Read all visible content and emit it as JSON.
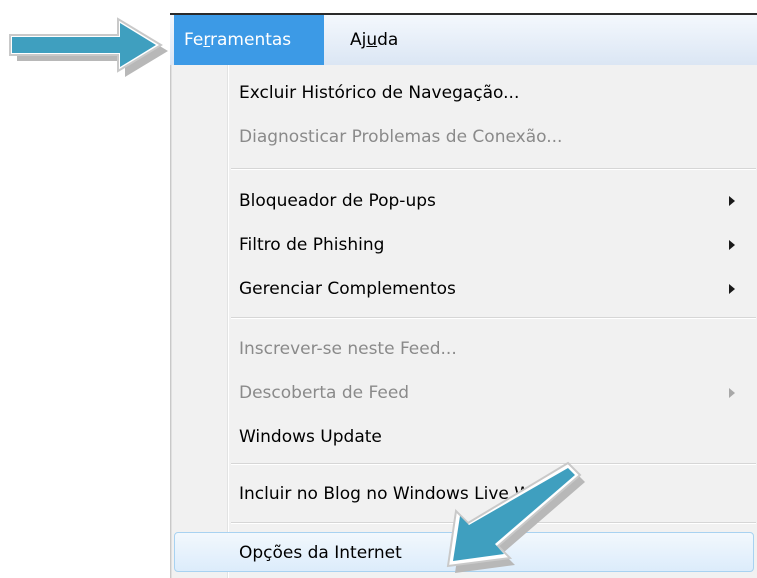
{
  "menubar": {
    "items": [
      {
        "label_pre": "Fe",
        "label_u": "r",
        "label_post": "ramentas"
      },
      {
        "label_pre": "Aj",
        "label_u": "u",
        "label_post": "da"
      }
    ]
  },
  "menu": {
    "items": [
      {
        "label": "Excluir Histórico de Navegação...",
        "enabled": true,
        "submenu": false
      },
      {
        "label": "Diagnosticar Problemas de Conexão...",
        "enabled": false,
        "submenu": false
      },
      {
        "label": "Bloqueador de Pop-ups",
        "enabled": true,
        "submenu": true
      },
      {
        "label": "Filtro de Phishing",
        "enabled": true,
        "submenu": true
      },
      {
        "label": "Gerenciar Complementos",
        "enabled": true,
        "submenu": true
      },
      {
        "label": "Inscrever-se neste Feed...",
        "enabled": false,
        "submenu": false
      },
      {
        "label": "Descoberta de Feed",
        "enabled": false,
        "submenu": true
      },
      {
        "label": "Windows Update",
        "enabled": true,
        "submenu": false
      },
      {
        "label": "Incluir no Blog no Windows Live Writer",
        "enabled": true,
        "submenu": false
      },
      {
        "label": "Opções da Internet",
        "enabled": true,
        "submenu": false,
        "highlighted": true
      }
    ]
  },
  "annotation_color": "#3f9fbf"
}
